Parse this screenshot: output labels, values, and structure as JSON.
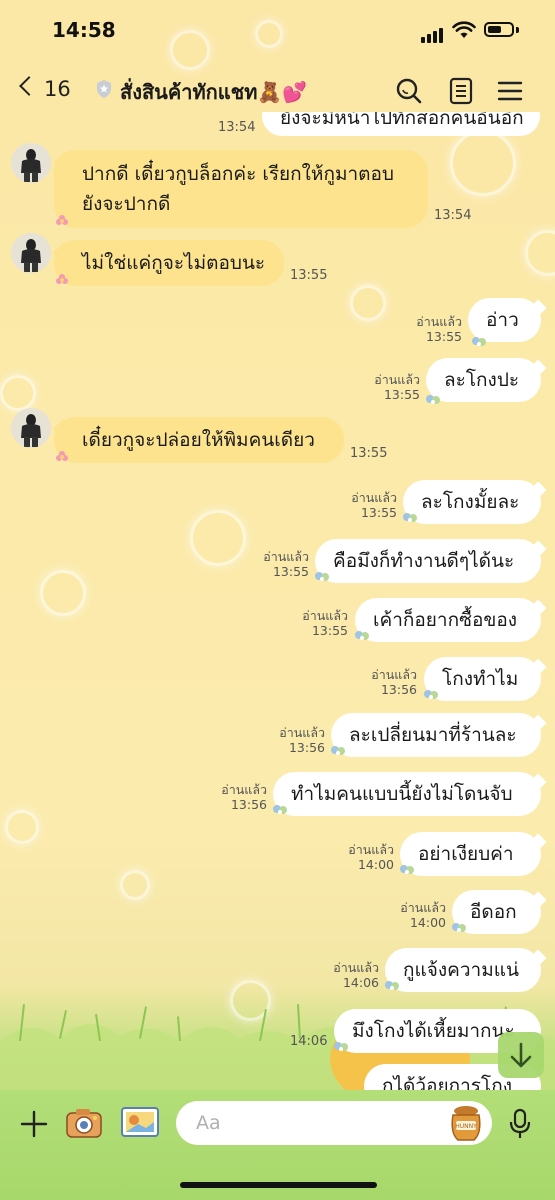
{
  "status_bar": {
    "time": "14:58"
  },
  "header": {
    "back_count": "16",
    "title": "สั่งสินค้าทักแชท🧸💕"
  },
  "messages": [
    {
      "side": "out",
      "text": "ยังจะมีหน้าไปทักสอกคนอื่นอีก",
      "read": "",
      "time": "13:54"
    },
    {
      "side": "in",
      "text_lines": [
        "ปากดี เดี๋ยวกูบล็อกค่ะ เรียกให้กูมาตอบ",
        "ยังจะปากดี"
      ],
      "time": "13:54"
    },
    {
      "side": "in",
      "text": "ไม่ใช่แค่กูจะไม่ตอบนะ",
      "time": "13:55"
    },
    {
      "side": "out",
      "text": "อ่าว",
      "read": "อ่านแล้ว",
      "time": "13:55"
    },
    {
      "side": "out",
      "text": "ละโกงปะ",
      "read": "อ่านแล้ว",
      "time": "13:55"
    },
    {
      "side": "in",
      "text": "เดี๋ยวกูจะปล่อยให้พิมคนเดียว",
      "time": "13:55"
    },
    {
      "side": "out",
      "text": "ละโกงมั้ยละ",
      "read": "อ่านแล้ว",
      "time": "13:55"
    },
    {
      "side": "out",
      "text": "คือมึงก็ทำงานดีๆได้นะ",
      "read": "อ่านแล้ว",
      "time": "13:55"
    },
    {
      "side": "out",
      "text": "เค้าก็อยากซื้อของ",
      "read": "อ่านแล้ว",
      "time": "13:55"
    },
    {
      "side": "out",
      "text": "โกงทำไม",
      "read": "อ่านแล้ว",
      "time": "13:56"
    },
    {
      "side": "out",
      "text": "ละเปลี่ยนมาที่ร้านละ",
      "read": "อ่านแล้ว",
      "time": "13:56"
    },
    {
      "side": "out",
      "text": "ทำไมคนแบบนี้ยังไม่โดนจับ",
      "read": "อ่านแล้ว",
      "time": "13:56"
    },
    {
      "side": "out",
      "text": "อย่าเงียบค่า",
      "read": "อ่านแล้ว",
      "time": "14:00"
    },
    {
      "side": "out",
      "text": "อีดอก",
      "read": "อ่านแล้ว",
      "time": "14:00"
    },
    {
      "side": "out",
      "text": "กูแจ้งความแน่",
      "read": "อ่านแล้ว",
      "time": "14:06"
    },
    {
      "side": "out",
      "text": "มึงโกงได้เหี้ยมากนะ",
      "read": "",
      "time": "14:06"
    },
    {
      "side": "out",
      "text": "กูได้ว้อยการโกง",
      "read": "",
      "time": ""
    }
  ],
  "input": {
    "placeholder": "Aa"
  },
  "colors": {
    "incoming_bubble": "#fde38d",
    "outgoing_bubble": "#ffffff",
    "background": "#fbe9a8",
    "bottom_bar": "#a7d86b"
  },
  "icons": [
    "back-chevron-icon",
    "shield-icon",
    "search-icon",
    "notes-icon",
    "menu-icon",
    "plus-icon",
    "camera-icon",
    "photo-icon",
    "honey-pot-icon",
    "mic-icon",
    "scroll-down-icon"
  ]
}
